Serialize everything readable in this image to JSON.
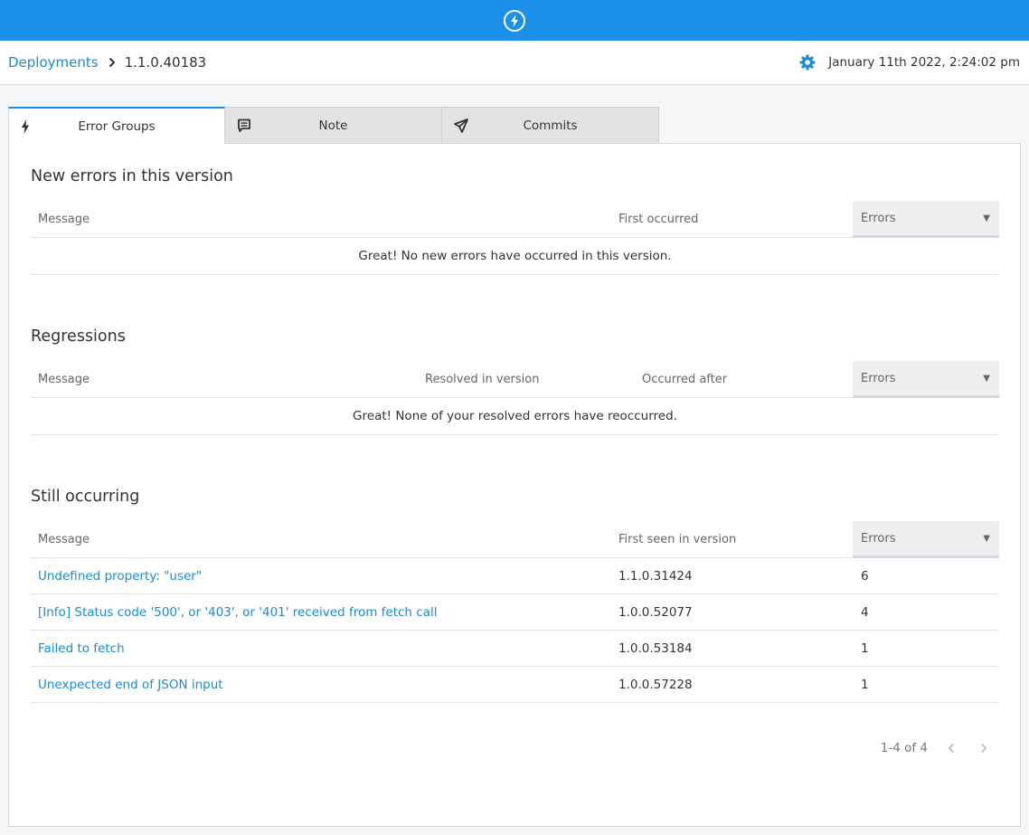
{
  "topbar": {
    "logo_icon": "bolt-circle-icon",
    "brand_color": "#1a90e8"
  },
  "breadcrumb": {
    "parent": "Deployments",
    "separator_icon": "chevron-right-icon",
    "current": "1.1.0.40183"
  },
  "header_meta": {
    "icon": "gear-icon",
    "timestamp": "January 11th 2022, 2:24:02 pm"
  },
  "tabs": [
    {
      "label": "Error Groups",
      "icon": "bolt-icon",
      "active": true
    },
    {
      "label": "Note",
      "icon": "comment-icon",
      "active": false
    },
    {
      "label": "Commits",
      "icon": "paper-plane-icon",
      "active": false
    }
  ],
  "sections": {
    "new_errors": {
      "title": "New errors in this version",
      "columns": [
        "Message",
        "First occurred",
        "Errors"
      ],
      "empty_message": "Great! No new errors have occurred in this version."
    },
    "regressions": {
      "title": "Regressions",
      "columns": [
        "Message",
        "Resolved in version",
        "Occurred after",
        "Errors"
      ],
      "empty_message": "Great! None of your resolved errors have reoccurred."
    },
    "still_occurring": {
      "title": "Still occurring",
      "columns": [
        "Message",
        "First seen in version",
        "Errors"
      ],
      "rows": [
        {
          "message": "Undefined property: \"user\"",
          "version": "1.1.0.31424",
          "errors": "6"
        },
        {
          "message": "[Info] Status code '500', or '403', or '401' received from fetch call",
          "version": "1.0.0.52077",
          "errors": "4"
        },
        {
          "message": "Failed to fetch",
          "version": "1.0.0.53184",
          "errors": "1"
        },
        {
          "message": "Unexpected end of JSON input",
          "version": "1.0.0.57228",
          "errors": "1"
        }
      ]
    }
  },
  "pagination": {
    "range": "1-4 of 4",
    "prev_icon": "chevron-left-icon",
    "next_icon": "chevron-right-icon"
  },
  "sort_caret": "▼"
}
